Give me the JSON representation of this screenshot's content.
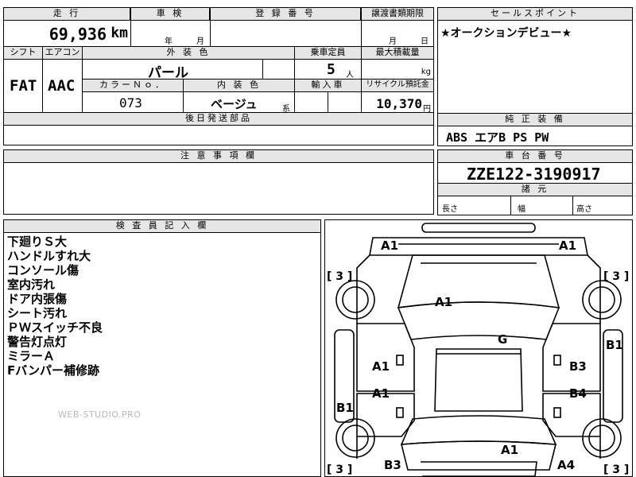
{
  "headers": {
    "mileage": "走 行",
    "inspection": "車 検",
    "registration_no": "登 録 番 号",
    "transfer_deadline": "譲渡書類期限",
    "sales_point": "セールスポイント",
    "shift": "シフト",
    "aircon": "エアコン",
    "exterior_color": "外 装 色",
    "capacity": "乗車定員",
    "max_load": "最大積載量",
    "color_no": "カラーＮｏ．",
    "interior_color": "内 装 色",
    "import": "輸入車",
    "recycle": "リサイクル預託金",
    "after_parts": "後日発送部品",
    "equipment": "純 正 装 備",
    "caution": "注 意 事 項 欄",
    "chassis_no": "車 台 番 号",
    "dimensions": "諸 元",
    "inspector": "検 査 員 記 入 欄"
  },
  "vehicle": {
    "mileage_value": "69,936",
    "mileage_unit": "km",
    "inspection_year": "年",
    "inspection_month": "月",
    "transfer_month": "月",
    "transfer_day": "日",
    "sales_point_text": "★オークションデビュー★",
    "shift_value": "FAT",
    "aircon_value": "AAC",
    "exterior_color_value": "パール",
    "capacity_value": "5",
    "capacity_unit": "人",
    "max_load_unit": "kg",
    "color_no_value": "073",
    "interior_color_value": "ベージュ",
    "interior_suffix": "系",
    "recycle_value": "10,370",
    "recycle_unit": "円",
    "equipment_value": "ABS エアB PS PW",
    "chassis_no_value": "ZZE122-3190917",
    "length_label": "長さ",
    "width_label": "幅",
    "height_label": "高さ"
  },
  "inspector_notes": [
    "下廻りＳ大",
    "ハンドルすれ大",
    "コンソール傷",
    "室内汚れ",
    "ドア内張傷",
    "シート汚れ",
    "ＰＷスイッチ不良",
    "警告灯点灯",
    "ミラーＡ",
    "Fバンパー補修跡"
  ],
  "diagram": {
    "front_left": "A1",
    "front_right": "A1",
    "bracket_fl": "[ 3 ]",
    "bracket_fr": "[ 3 ]",
    "bracket_rl": "[ 3 ]",
    "bracket_rr": "[ 3 ]",
    "hood": "A1",
    "roof": "G",
    "right_fender": "B1",
    "left_front_door": "A1",
    "right_front_door": "B3",
    "left_rear_door": "A1",
    "right_rear_door": "B4",
    "left_quarter": "B1",
    "trunk": "A1",
    "rear_left": "B3",
    "rear_right": "A4"
  },
  "watermark": "WEB-STUDIO.PRO"
}
